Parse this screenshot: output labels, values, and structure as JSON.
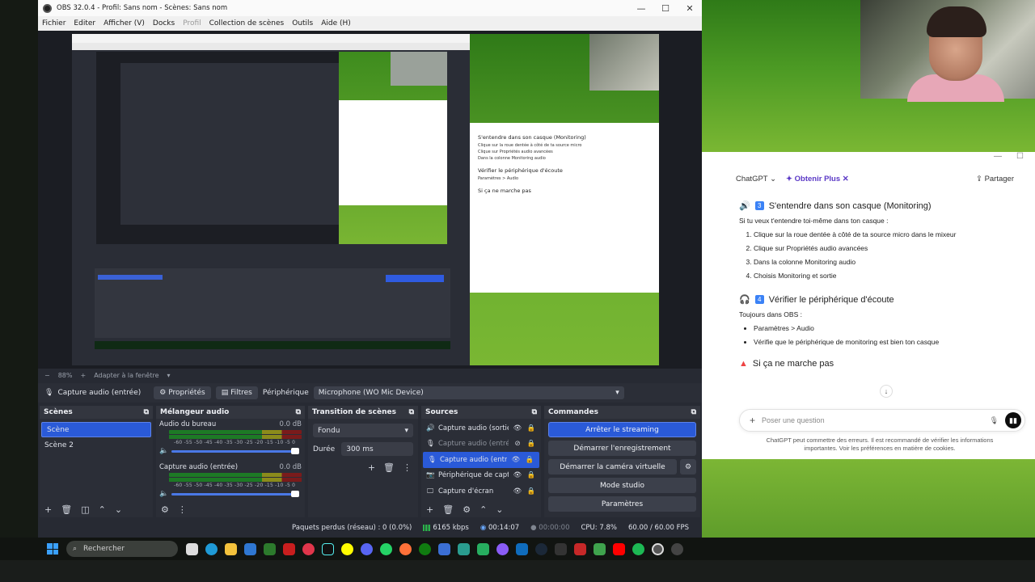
{
  "obs": {
    "window_title": "OBS 32.0.4 - Profil: Sans nom - Scènes: Sans nom",
    "menu": [
      "Fichier",
      "Editer",
      "Afficher (V)",
      "Docks",
      "Profil",
      "Collection de scènes",
      "Outils",
      "Aide (H)"
    ],
    "zoom": "88%",
    "zoom_mode": "Adapter à la fenêtre",
    "source_bar": {
      "source": "Capture audio (entrée)",
      "properties": "Propriétés",
      "filters": "Filtres",
      "device_label": "Périphérique",
      "device_value": "Microphone (WO Mic Device)"
    },
    "scenes": {
      "title": "Scènes",
      "items": [
        "Scène",
        "Scène 2"
      ]
    },
    "mixer": {
      "title": "Mélangeur audio",
      "channels": [
        {
          "name": "Audio du bureau",
          "level": "0.0 dB"
        },
        {
          "name": "Capture audio (entrée)",
          "level": "0.0 dB"
        }
      ],
      "ticks": "-60 -55 -50 -45 -40 -35 -30 -25 -20 -15 -10 -5 0"
    },
    "transitions": {
      "title": "Transition de scènes",
      "type": "Fondu",
      "duration_label": "Durée",
      "duration": "300 ms"
    },
    "sources": {
      "title": "Sources",
      "items": [
        "Capture audio (sortie)",
        "Capture audio (entrée)",
        "Capture audio (entrée)",
        "Périphérique de capture",
        "Capture d'écran"
      ]
    },
    "commands": {
      "title": "Commandes",
      "stop_stream": "Arrêter le streaming",
      "start_record": "Démarrer l'enregistrement",
      "start_vcam": "Démarrer la caméra virtuelle",
      "studio_mode": "Mode studio",
      "settings": "Paramètres"
    },
    "status": {
      "dropped": "Paquets perdus (réseau) : 0 (0.0%)",
      "bitrate": "6165 kbps",
      "stream_time": "00:14:07",
      "rec_time": "00:00:00",
      "cpu": "CPU: 7.8%",
      "fps": "60.00 / 60.00 FPS"
    }
  },
  "chat": {
    "brand": "ChatGPT",
    "plus": "Obtenir Plus",
    "share": "Partager",
    "s3_num": "3",
    "s3_title": "S'entendre dans son casque (Monitoring)",
    "s3_intro": "Si tu veux t'entendre toi-même dans ton casque :",
    "s3_steps": [
      "Clique sur la roue dentée à côté de ta source micro dans le mixeur",
      "Clique sur Propriétés audio avancées",
      "Dans la colonne Monitoring audio",
      "Choisis Monitoring et sortie"
    ],
    "s4_num": "4",
    "s4_title": "Vérifier le périphérique d'écoute",
    "s4_intro": "Toujours dans OBS :",
    "s4_items": [
      "Paramètres > Audio",
      "Vérifie que le périphérique de monitoring est bien ton casque"
    ],
    "s5_title": "Si ça ne marche pas",
    "input_placeholder": "Poser une question",
    "disclaimer": "ChatGPT peut commettre des erreurs. Il est recommandé de vérifier les informations importantes. Voir les préférences en matière de cookies."
  },
  "taskbar": {
    "search_placeholder": "Rechercher"
  }
}
